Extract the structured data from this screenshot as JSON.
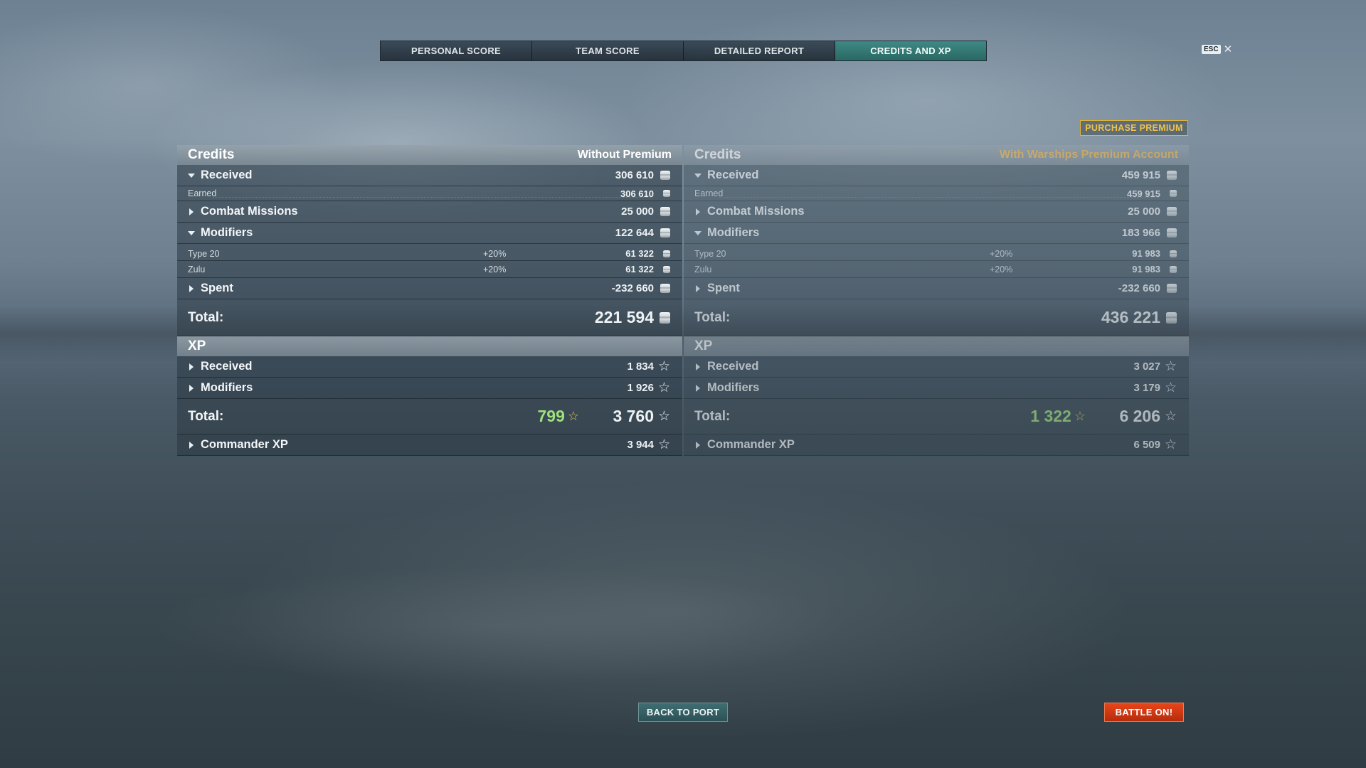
{
  "tabs": [
    {
      "label": "PERSONAL SCORE"
    },
    {
      "label": "TEAM SCORE"
    },
    {
      "label": "DETAILED REPORT"
    },
    {
      "label": "CREDITS AND XP"
    }
  ],
  "esc": {
    "key": "ESC",
    "close": "✕"
  },
  "purchase_premium": "PURCHASE PREMIUM",
  "left": {
    "credits_title": "Credits",
    "credits_sub": "Without Premium",
    "received": {
      "label": "Received",
      "value": "306 610"
    },
    "earned": {
      "label": "Earned",
      "value": "306 610"
    },
    "combat_missions": {
      "label": "Combat Missions",
      "value": "25 000"
    },
    "modifiers": {
      "label": "Modifiers",
      "value": "122 644"
    },
    "type20": {
      "label": "Type 20",
      "pct": "+20%",
      "value": "61 322"
    },
    "zulu": {
      "label": "Zulu",
      "pct": "+20%",
      "value": "61 322"
    },
    "spent": {
      "label": "Spent",
      "value": "-232 660"
    },
    "total": {
      "label": "Total:",
      "value": "221 594"
    },
    "xp_title": "XP",
    "xp_received": {
      "label": "Received",
      "value": "1 834"
    },
    "xp_modifiers": {
      "label": "Modifiers",
      "value": "1 926"
    },
    "xp_total": {
      "label": "Total:",
      "premium_value": "799",
      "value": "3 760"
    },
    "commander_xp": {
      "label": "Commander XP",
      "value": "3 944"
    }
  },
  "right": {
    "credits_title": "Credits",
    "credits_sub": "With Warships Premium Account",
    "received": {
      "label": "Received",
      "value": "459 915"
    },
    "earned": {
      "label": "Earned",
      "value": "459 915"
    },
    "combat_missions": {
      "label": "Combat Missions",
      "value": "25 000"
    },
    "modifiers": {
      "label": "Modifiers",
      "value": "183 966"
    },
    "type20": {
      "label": "Type 20",
      "pct": "+20%",
      "value": "91 983"
    },
    "zulu": {
      "label": "Zulu",
      "pct": "+20%",
      "value": "91 983"
    },
    "spent": {
      "label": "Spent",
      "value": "-232 660"
    },
    "total": {
      "label": "Total:",
      "value": "436 221"
    },
    "xp_title": "XP",
    "xp_received": {
      "label": "Received",
      "value": "3 027"
    },
    "xp_modifiers": {
      "label": "Modifiers",
      "value": "3 179"
    },
    "xp_total": {
      "label": "Total:",
      "premium_value": "1 322",
      "value": "6 206"
    },
    "commander_xp": {
      "label": "Commander XP",
      "value": "6 509"
    }
  },
  "buttons": {
    "back_to_port": "BACK TO PORT",
    "battle_on": "BATTLE ON!"
  },
  "icons": {
    "credits": "credit-coin-icon",
    "xp": "star-icon",
    "premium_xp": "gold-star-icon"
  },
  "colors": {
    "active_tab": "#2f7672",
    "premium_gold": "#f0b64a",
    "premium_xp_green": "#9fe07c",
    "battle_button": "#d43a14"
  }
}
